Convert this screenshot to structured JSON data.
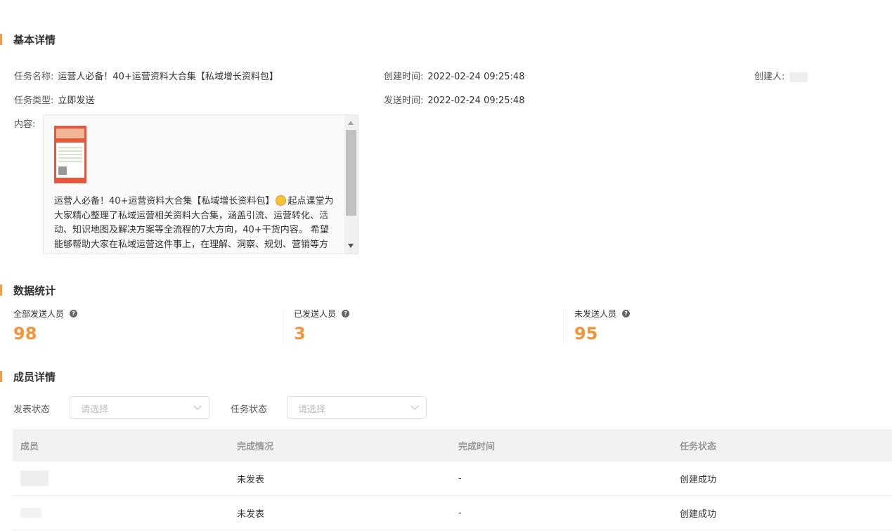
{
  "basic": {
    "section_title": "基本详情",
    "task_name_label": "任务名称:",
    "task_name": "运营人必备！40+运营资料大合集【私域增长资料包】",
    "task_type_label": "任务类型:",
    "task_type": "立即发送",
    "content_label": "内容:",
    "created_time_label": "创建时间:",
    "created_time": "2022-02-24 09:25:48",
    "send_time_label": "发送时间:",
    "send_time": "2022-02-24 09:25:48",
    "creator_label": "创建人:",
    "content_text_1": "运营人必备！40+运营资料大合集【私域增长资料包】",
    "content_text_2": "起点课堂为大家精心整理了私域运营相关资料大合集，涵盖引流、运营转化、活动、知识地图及解决方案等全流程的7大方向，40+干货内容。 希望能够帮助大家在私域运营这件事上，在理解、洞察、规划、营销等方向，都能够有所精进，做到个人和企"
  },
  "stats": {
    "section_title": "数据统计",
    "items": [
      {
        "label": "全部发送人员",
        "value": "98"
      },
      {
        "label": "已发送人员",
        "value": "3"
      },
      {
        "label": "未发送人员",
        "value": "95"
      }
    ],
    "help_glyph": "?"
  },
  "members": {
    "section_title": "成员详情",
    "filter_publish_label": "发表状态",
    "filter_publish_placeholder": "请选择",
    "filter_task_label": "任务状态",
    "filter_task_placeholder": "请选择",
    "columns": [
      "成员",
      "完成情况",
      "完成时间",
      "任务状态"
    ],
    "rows": [
      {
        "completion": "未发表",
        "time": "-",
        "status": "创建成功"
      },
      {
        "completion": "未发表",
        "time": "-",
        "status": "创建成功"
      }
    ]
  },
  "colors": {
    "accent": "#f0953b",
    "section_bar": "#f0a04a"
  }
}
